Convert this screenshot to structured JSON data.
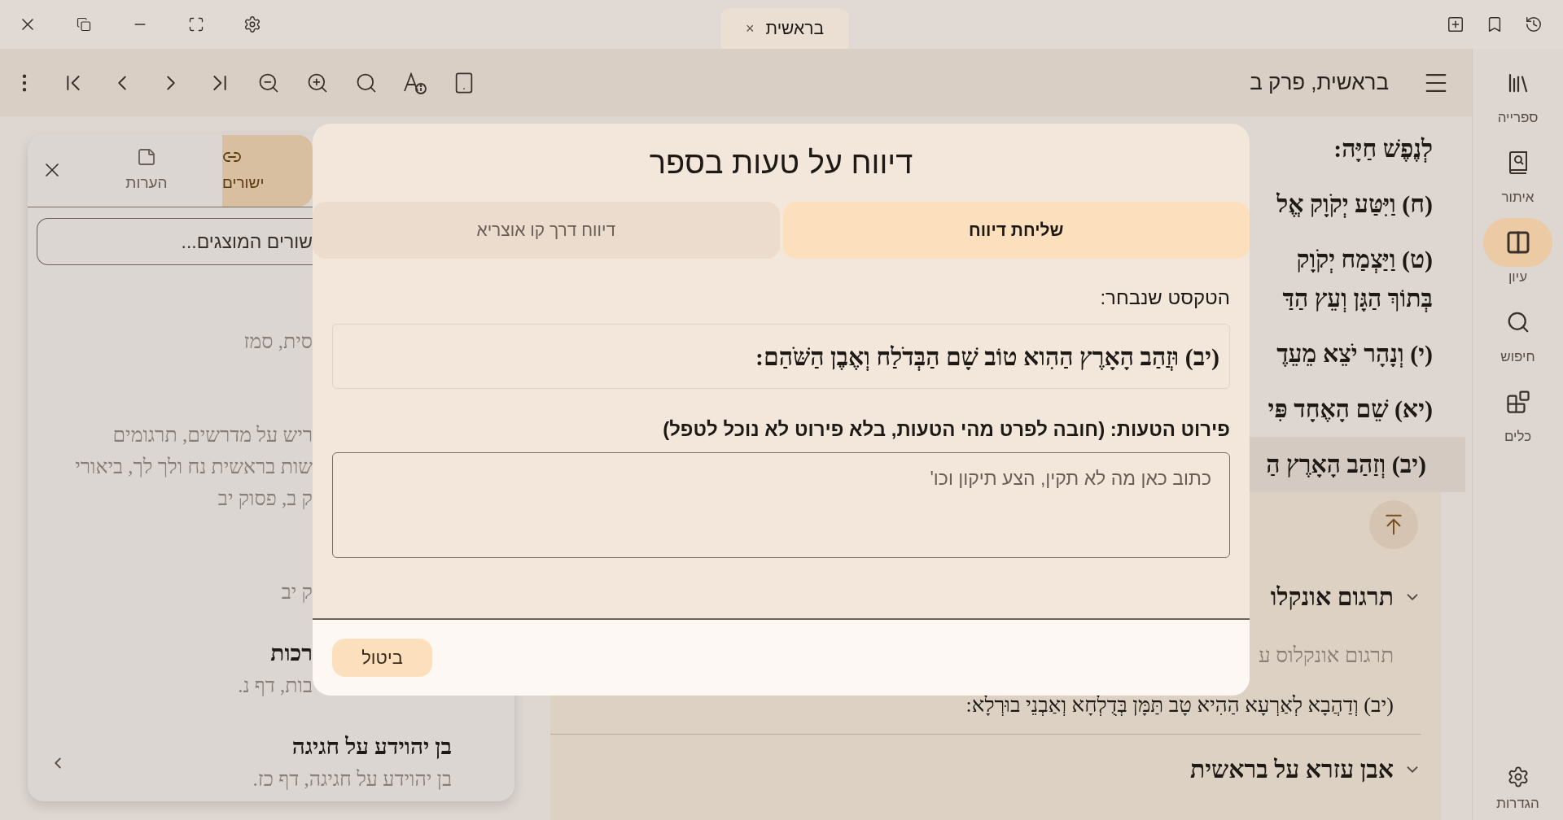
{
  "title_bar": {
    "tab": {
      "label": "בראשית",
      "close": "×"
    }
  },
  "toolbar": {
    "location": "בראשית, פרק ב"
  },
  "nav_rail": {
    "items": [
      {
        "kind": "library",
        "label": "ספרייה",
        "selected": false
      },
      {
        "kind": "locate",
        "label": "איתור",
        "selected": false
      },
      {
        "kind": "study",
        "label": "עיון",
        "selected": true
      },
      {
        "kind": "search",
        "label": "חיפוש",
        "selected": false
      },
      {
        "kind": "tools",
        "label": "כלים",
        "selected": false
      }
    ],
    "settings": {
      "label": "הגדרות"
    }
  },
  "reader": {
    "verses": [
      {
        "lines": [
          "לְנֶפֶשׁ חַיָּה:"
        ],
        "selected": false
      },
      {
        "lines": [
          "(ח) וַיִּטַּע יְקֹוָק אֱל"
        ],
        "selected": false
      },
      {
        "lines": [
          "(ט) וַיַּצְמַח יְקֹוָק",
          "בְּתוֹךְ הַגָּן וְעֵץ הַדַּ"
        ],
        "selected": false
      },
      {
        "lines": [
          "(י) וְנָהָר יֹצֵא מֵעֵדֶ"
        ],
        "selected": false
      },
      {
        "lines": [
          "(יא) שֵׁם הָאֶחָד פִּי"
        ],
        "selected": false
      },
      {
        "lines": [
          "(יב) וְזַהַב הָאָרֶץ הַ"
        ],
        "selected": true
      }
    ],
    "commentaries": [
      {
        "title": "תרגום אונקלו",
        "expanded": true,
        "source": "תרגום אונקלוס ע",
        "text": "(יב) וְדַהֲבָא לְאַרְעָא הַהִיא טָב תַּמָּן בְּדֻלְחָא וְאַבְנֵי בוּרְלָא:"
      },
      {
        "title": "אבן עזרא על בראשית",
        "expanded": true
      }
    ]
  },
  "side_panel": {
    "tabs": [
      {
        "kind": "links",
        "label": "ישורים",
        "selected": true
      },
      {
        "kind": "notes",
        "label": "הערות",
        "selected": false
      }
    ],
    "search": {
      "placeholder": "שורים המוצגים..."
    },
    "results": [
      {
        "lines": [
          "סית, סמז"
        ],
        "hovered": false
      },
      {
        "lines": [
          "ריש על מדרשים, תרגומים",
          "שות בראשית נח ולך לך, ביאורי",
          "ק ב, פסוק יב"
        ],
        "hovered": false
      },
      {
        "lines": [
          "ק יב"
        ],
        "hovered": false
      },
      {
        "title": "רכות",
        "lines": [
          "בות, דף נ."
        ],
        "hovered": false
      },
      {
        "title": "בן יהוידע על חגיגה",
        "lines": [
          "בן יהוידע על חגיגה, דף כז."
        ],
        "hovered": true
      }
    ]
  },
  "dialog": {
    "title": "דיווח על טעות בספר",
    "tabs": [
      {
        "label": "שליחת דיווח",
        "selected": true
      },
      {
        "label": "דיווח דרך קו אוצריא",
        "selected": false
      }
    ],
    "selected_text_label": "הטקסט שנבחר:",
    "selected_text": "(יב) וּזֲהַב הָאָרֶץ הַהִוא טוֹב שָׁם הַבְּדֹלַח וְאֶבֶן הַשֹּׁהַם:",
    "details_label": "פירוט הטעות: (חובה לפרט מהי הטעות, בלא פירוט לא נוכל לטפל)",
    "details": {
      "placeholder": "כתוב כאן מה לא תקין, הצע תיקון וכו'"
    },
    "cancel": "ביטול"
  }
}
